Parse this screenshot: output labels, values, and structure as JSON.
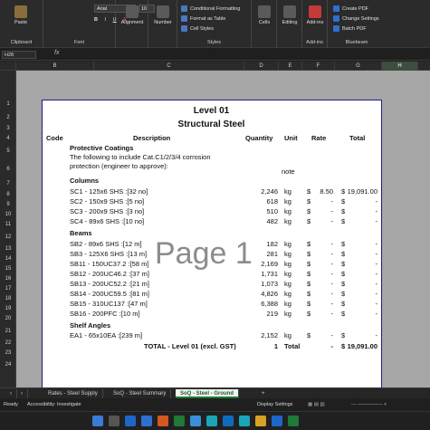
{
  "ribbon": {
    "clipboard": {
      "paste_label": "Paste",
      "group_label": "Clipboard"
    },
    "font": {
      "font_name": "Arial",
      "font_size": "10",
      "group_label": "Font"
    },
    "alignment": {
      "label": "Alignment"
    },
    "number": {
      "label": "Number"
    },
    "styles": {
      "conditional": "Conditional Formatting",
      "format_table": "Format as Table",
      "cell_styles": "Cell Styles",
      "group_label": "Styles"
    },
    "cells": {
      "label": "Cells"
    },
    "editing": {
      "label": "Editing"
    },
    "addins": {
      "label": "Add-ins",
      "group_label": "Add-ins"
    },
    "bluebeam": {
      "create_pdf": "Create PDF",
      "change_settings": "Change Settings",
      "batch_pdf": "Batch PDF",
      "group_label": "Bluebeam"
    }
  },
  "formula_bar": {
    "name_box": "H28",
    "fx": "fx",
    "formula": ""
  },
  "columns": [
    "B",
    "C",
    "D",
    "E",
    "F",
    "G",
    "H"
  ],
  "rows": [
    "1",
    "2",
    "3",
    "4",
    "5",
    "6",
    "7",
    "8",
    "9",
    "10",
    "11",
    "12",
    "13",
    "14",
    "15",
    "16",
    "17",
    "18",
    "19",
    "20",
    "21",
    "22",
    "23",
    "24"
  ],
  "sheet": {
    "title": "Level 01",
    "subtitle": "Structural Steel",
    "headers": {
      "code": "Code",
      "description": "Description",
      "quantity": "Quantity",
      "unit": "Unit",
      "rate": "Rate",
      "total": "Total"
    },
    "watermark": "Page 1",
    "lines": [
      {
        "row": "5",
        "desc": "Protective Coatings",
        "bold": true
      },
      {
        "row": "6a",
        "desc": "The following to include Cat.C1/2/3/4 corrosion"
      },
      {
        "row": "6b",
        "desc": "protection (engineer to approve):",
        "unit": "note"
      },
      {
        "row": "7",
        "desc": "Columns",
        "bold": true
      },
      {
        "row": "8",
        "desc": "SC1 - 125x6 SHS :[32 no]",
        "qty": "2,246",
        "unit": "kg",
        "rate_sym": "$",
        "rate": "8.50",
        "tot_sym": "$",
        "total": "19,091.00"
      },
      {
        "row": "9",
        "desc": "SC2 - 150x9 SHS :[5 no]",
        "qty": "618",
        "unit": "kg",
        "rate_sym": "$",
        "rate": "-",
        "tot_sym": "$",
        "total": "-"
      },
      {
        "row": "10",
        "desc": "SC3 - 200x9 SHS :[3 no]",
        "qty": "510",
        "unit": "kg",
        "rate_sym": "$",
        "rate": "-",
        "tot_sym": "$",
        "total": "-"
      },
      {
        "row": "11",
        "desc": "SC4 - 89x6 SHS :[10 no]",
        "qty": "482",
        "unit": "kg",
        "rate_sym": "$",
        "rate": "-",
        "tot_sym": "$",
        "total": "-"
      },
      {
        "row": "12",
        "desc": "Beams",
        "bold": true
      },
      {
        "row": "13",
        "desc": "SB2 - 89x6 SHS :[12 m]",
        "qty": "182",
        "unit": "kg",
        "rate_sym": "$",
        "rate": "-",
        "tot_sym": "$",
        "total": "-"
      },
      {
        "row": "14",
        "desc": "SB3 - 125X6 SHS :[13 m]",
        "qty": "281",
        "unit": "kg",
        "rate_sym": "$",
        "rate": "-",
        "tot_sym": "$",
        "total": "-"
      },
      {
        "row": "15",
        "desc": "SB11 - 150UC37.2 :[58 m]",
        "qty": "2,169",
        "unit": "kg",
        "rate_sym": "$",
        "rate": "-",
        "tot_sym": "$",
        "total": "-"
      },
      {
        "row": "16",
        "desc": "SB12 - 200UC46.2 :[37 m]",
        "qty": "1,731",
        "unit": "kg",
        "rate_sym": "$",
        "rate": "-",
        "tot_sym": "$",
        "total": "-"
      },
      {
        "row": "17",
        "desc": "SB13 - 200UC52.2 :[21 m]",
        "qty": "1,073",
        "unit": "kg",
        "rate_sym": "$",
        "rate": "-",
        "tot_sym": "$",
        "total": "-"
      },
      {
        "row": "18",
        "desc": "SB14 - 200UC59.5 :[81 m]",
        "qty": "4,826",
        "unit": "kg",
        "rate_sym": "$",
        "rate": "-",
        "tot_sym": "$",
        "total": "-"
      },
      {
        "row": "19",
        "desc": "SB15 - 310UC137 :[47 m]",
        "qty": "6,388",
        "unit": "kg",
        "rate_sym": "$",
        "rate": "-",
        "tot_sym": "$",
        "total": "-"
      },
      {
        "row": "20",
        "desc": "SB16 - 200PFC :[10 m]",
        "qty": "219",
        "unit": "kg",
        "rate_sym": "$",
        "rate": "-",
        "tot_sym": "$",
        "total": "-"
      },
      {
        "row": "21",
        "desc": "Shelf Angles",
        "bold": true
      },
      {
        "row": "22",
        "desc": "EA1 - 65x10EA :[239 m]",
        "qty": "2,152",
        "unit": "kg",
        "rate_sym": "$",
        "rate": "-",
        "tot_sym": "$",
        "total": "-"
      },
      {
        "row": "23",
        "desc": "TOTAL - Level 01 (excl. GST)",
        "qty": "1",
        "unit": "Total",
        "rate": "-",
        "tot_sym": "$",
        "total": "19,091.00",
        "bold": true,
        "total_row": true
      }
    ]
  },
  "tabs": [
    "Rates - Steel Supply",
    "SoQ - Steel Summary",
    "SoQ - Steel - Ground"
  ],
  "active_tab": 2,
  "status": {
    "ready": "Ready",
    "accessibility": "Accessibility: Investigate",
    "display": "Display Settings"
  },
  "colors": {
    "accent": "#1b7a34",
    "page_border": "#1c1c8a",
    "grid_bg": "#a6a6a6"
  }
}
